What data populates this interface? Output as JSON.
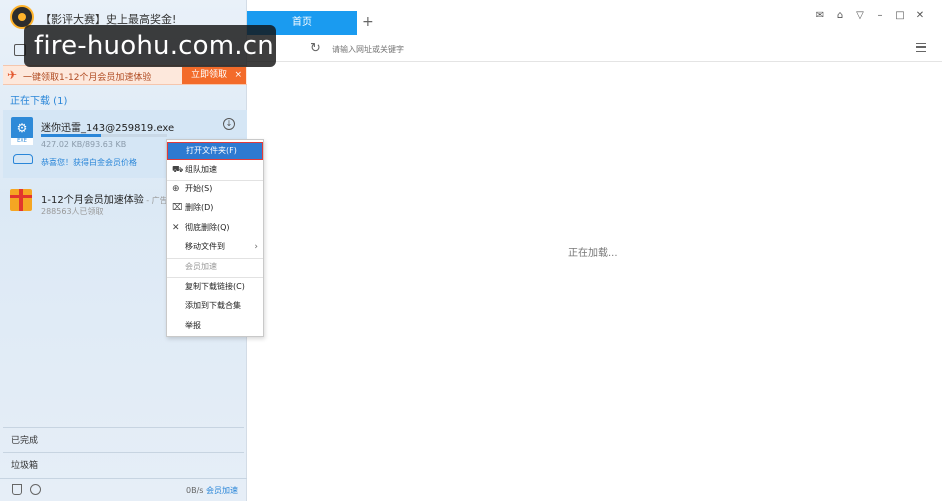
{
  "header": {
    "promo_title": "【影评大赛】史上最高奖金!",
    "watermark": "fire-huohu.com.cn"
  },
  "banner": {
    "text": "一键领取1-12个月会员加速体验",
    "button_label": "立即领取",
    "close": "×"
  },
  "downloading": {
    "title": "正在下载 (1)",
    "task": {
      "name": "迷你迅雷_143@259819.exe",
      "size": "427.02 KB/893.63 KB",
      "progress": 0.48,
      "vip_text": "恭喜您！获得白金会员价格",
      "icon_tag": "EXE"
    }
  },
  "ad": {
    "title": "1-12个月会员加速体验",
    "tag": " - 广告",
    "subtitle": "288563人已领取"
  },
  "sidebar_bottom": {
    "completed": "已完成",
    "trash": "垃圾箱",
    "speed": "0B/s",
    "speed_link": "会员加速"
  },
  "browser": {
    "tab_label": "首页",
    "tab_add": "+",
    "address_placeholder": "请输入网址或关键字",
    "loading_text": "正在加载..."
  },
  "context_menu": {
    "items": [
      {
        "label": "打开文件夹(F)",
        "icon": "",
        "state": "highlight"
      },
      {
        "label": "组队加速",
        "icon": "team-icon",
        "state": "normal"
      },
      {
        "label": "开始(S)",
        "icon": "play-icon",
        "state": "normal"
      },
      {
        "label": "删除(D)",
        "icon": "trash-icon",
        "state": "normal"
      },
      {
        "label": "彻底删除(Q)",
        "icon": "x-icon",
        "state": "normal"
      },
      {
        "label": "移动文件到",
        "icon": "",
        "state": "submenu"
      },
      {
        "label": "会员加速",
        "icon": "",
        "state": "disabled"
      },
      {
        "label": "复制下载链接(C)",
        "icon": "",
        "state": "normal"
      },
      {
        "label": "添加到下载合集",
        "icon": "",
        "state": "normal"
      },
      {
        "label": "举报",
        "icon": "",
        "state": "normal"
      }
    ]
  }
}
